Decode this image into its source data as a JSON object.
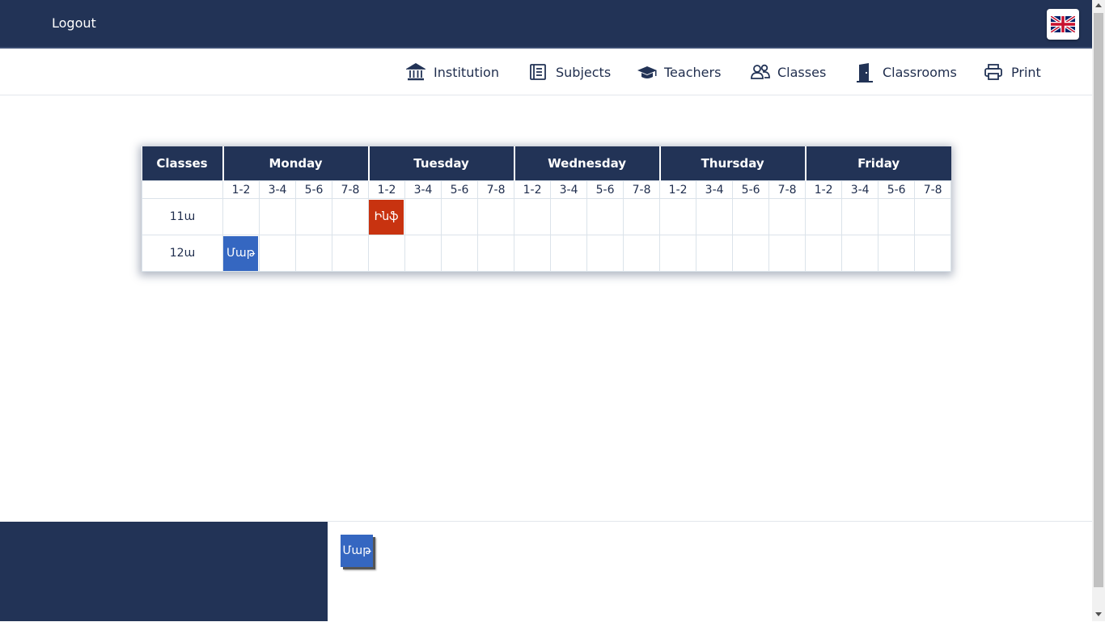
{
  "topbar": {
    "logout_label": "Logout",
    "language_icon": "uk-flag-icon"
  },
  "nav": {
    "items": [
      {
        "label": "Institution",
        "icon": "institution-icon"
      },
      {
        "label": "Subjects",
        "icon": "subjects-icon"
      },
      {
        "label": "Teachers",
        "icon": "teachers-icon"
      },
      {
        "label": "Classes",
        "icon": "classes-icon"
      },
      {
        "label": "Classrooms",
        "icon": "classroom-door-icon"
      },
      {
        "label": "Print",
        "icon": "printer-icon"
      }
    ]
  },
  "schedule": {
    "first_col_header": "Classes",
    "days": [
      "Monday",
      "Tuesday",
      "Wednesday",
      "Thursday",
      "Friday"
    ],
    "slots": [
      "1-2",
      "3-4",
      "5-6",
      "7-8"
    ],
    "rows": [
      {
        "class": "11ա",
        "cells": {
          "1_0": "Ինֆ"
        }
      },
      {
        "class": "12ա",
        "cells": {
          "0_0": "Մաթ"
        }
      }
    ]
  },
  "colors": {
    "navy": "#223356",
    "tile_red": "#c83310",
    "tile_blue": "#3567c1"
  },
  "tray": {
    "tiles": [
      {
        "label": "Մաթ"
      }
    ]
  }
}
